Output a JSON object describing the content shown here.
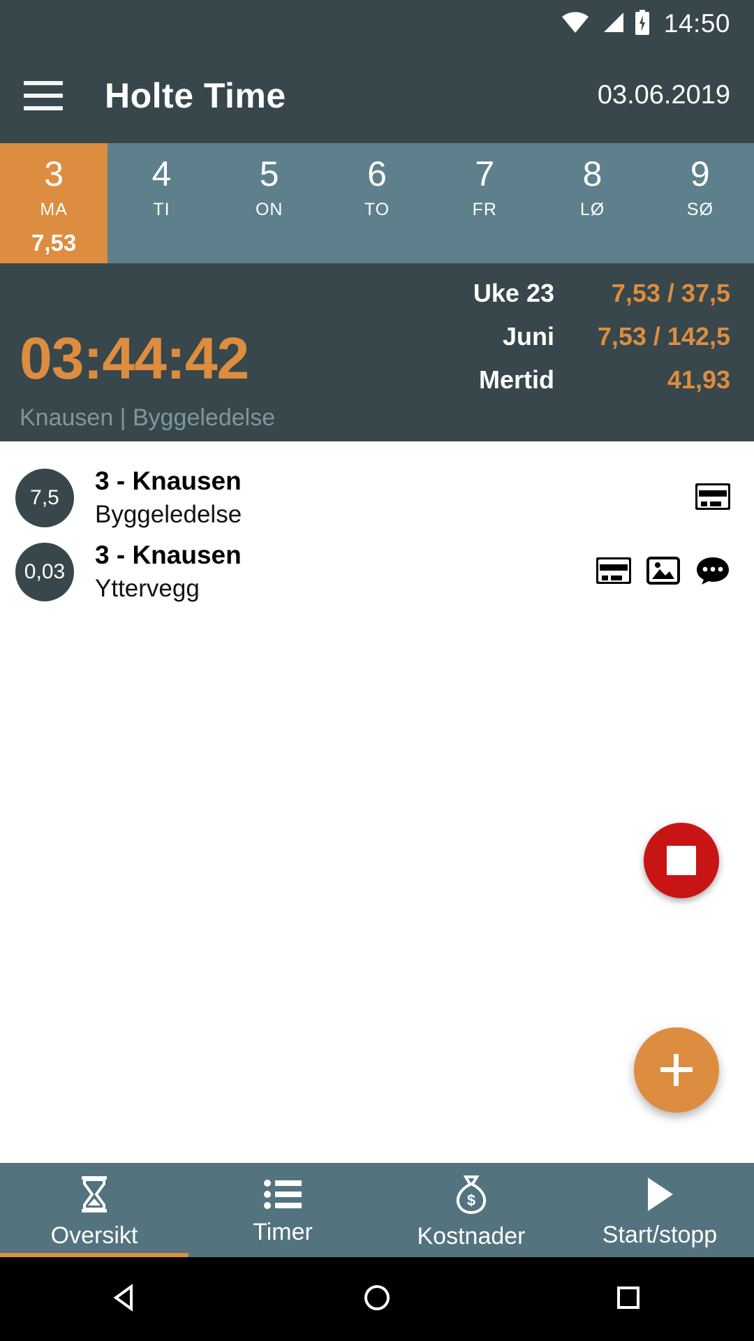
{
  "status_bar": {
    "time": "14:50",
    "icons": [
      "wifi-icon",
      "cellular-signal-icon",
      "battery-charging-icon"
    ]
  },
  "app_bar": {
    "menu_icon": "hamburger-menu-icon",
    "title": "Holte Time",
    "date": "03.06.2019"
  },
  "day_strip": {
    "days": [
      {
        "num": "3",
        "abbr": "MA",
        "hours": "7,53",
        "selected": true
      },
      {
        "num": "4",
        "abbr": "TI",
        "hours": "",
        "selected": false
      },
      {
        "num": "5",
        "abbr": "ON",
        "hours": "",
        "selected": false
      },
      {
        "num": "6",
        "abbr": "TO",
        "hours": "",
        "selected": false
      },
      {
        "num": "7",
        "abbr": "FR",
        "hours": "",
        "selected": false
      },
      {
        "num": "8",
        "abbr": "LØ",
        "hours": "",
        "selected": false
      },
      {
        "num": "9",
        "abbr": "SØ",
        "hours": "",
        "selected": false
      }
    ]
  },
  "timer_panel": {
    "elapsed": "03:44:42",
    "subtitle": "Knausen | Byggeledelse",
    "summary": [
      {
        "label": "Uke 23",
        "value": "7,53 / 37,5"
      },
      {
        "label": "Juni",
        "value": "7,53 / 142,5"
      },
      {
        "label": "Mertid",
        "value": "41,93"
      }
    ],
    "stop_button": "stop-timer-button"
  },
  "entries": [
    {
      "hours": "7,5",
      "title": "3 - Knausen",
      "subtitle": "Byggeledelse",
      "icons": [
        "cost-card-icon"
      ]
    },
    {
      "hours": "0,03",
      "title": "3 - Knausen",
      "subtitle": "Yttervegg",
      "icons": [
        "cost-card-icon",
        "image-icon",
        "comment-icon"
      ]
    }
  ],
  "fab": {
    "label": "+",
    "name": "add-entry-fab"
  },
  "bottom_nav": {
    "items": [
      {
        "label": "Oversikt",
        "icon": "hourglass-icon",
        "active": true
      },
      {
        "label": "Timer",
        "icon": "list-icon",
        "active": false
      },
      {
        "label": "Kostnader",
        "icon": "money-bag-icon",
        "active": false
      },
      {
        "label": "Start/stopp",
        "icon": "play-icon",
        "active": false
      }
    ]
  },
  "android_nav": {
    "back": "back-triangle-icon",
    "home": "home-circle-icon",
    "recents": "recents-square-icon"
  },
  "colors": {
    "header_bg": "#37474b",
    "strip_bg": "#5d808c",
    "accent": "#dd8d3f",
    "stop_red": "#c81414",
    "nav_bg": "#53737e"
  }
}
